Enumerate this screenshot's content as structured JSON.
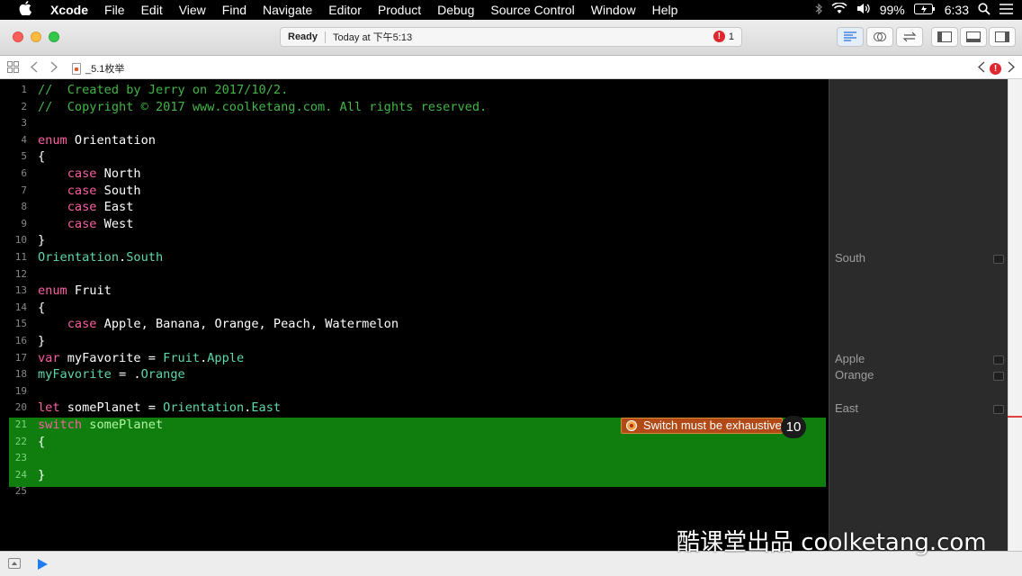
{
  "menubar": {
    "app": "Xcode",
    "items": [
      "File",
      "Edit",
      "View",
      "Find",
      "Navigate",
      "Editor",
      "Product",
      "Debug",
      "Source Control",
      "Window",
      "Help"
    ],
    "battery": "99%",
    "time": "6:33",
    "icons": [
      "apple-icon",
      "bluetooth-icon",
      "wifi-icon",
      "volume-icon",
      "battery-icon",
      "spotlight-icon"
    ]
  },
  "toolbar": {
    "status": "Ready",
    "timestamp": "Today at 下午5:13",
    "error_count": "1",
    "buttons": [
      "standard-editor-icon",
      "assistant-editor-icon",
      "version-editor-icon",
      "navigator-toggle-icon",
      "debug-area-toggle-icon",
      "utilities-toggle-icon"
    ]
  },
  "jumpbar": {
    "file": "_5.1枚举",
    "icons": [
      "related-items-icon",
      "back-icon",
      "forward-icon",
      "swift-file-icon",
      "previous-issue-icon",
      "error-icon",
      "next-issue-icon"
    ]
  },
  "editor": {
    "lines": [
      {
        "n": "1",
        "parts": [
          {
            "t": "//  Created by Jerry on 2017/10/2.",
            "c": "comment"
          }
        ]
      },
      {
        "n": "2",
        "parts": [
          {
            "t": "//  Copyright © 2017 www.coolketang.com. All rights reserved.",
            "c": "comment"
          }
        ]
      },
      {
        "n": "3",
        "parts": []
      },
      {
        "n": "4",
        "parts": [
          {
            "t": "enum",
            "c": "kw"
          },
          {
            "t": " Orientation",
            "c": "plain"
          }
        ]
      },
      {
        "n": "5",
        "parts": [
          {
            "t": "{",
            "c": "plain"
          }
        ]
      },
      {
        "n": "6",
        "parts": [
          {
            "t": "    ",
            "c": "plain"
          },
          {
            "t": "case",
            "c": "kw"
          },
          {
            "t": " North",
            "c": "plain"
          }
        ]
      },
      {
        "n": "7",
        "parts": [
          {
            "t": "    ",
            "c": "plain"
          },
          {
            "t": "case",
            "c": "kw"
          },
          {
            "t": " South",
            "c": "plain"
          }
        ]
      },
      {
        "n": "8",
        "parts": [
          {
            "t": "    ",
            "c": "plain"
          },
          {
            "t": "case",
            "c": "kw"
          },
          {
            "t": " East",
            "c": "plain"
          }
        ]
      },
      {
        "n": "9",
        "parts": [
          {
            "t": "    ",
            "c": "plain"
          },
          {
            "t": "case",
            "c": "kw"
          },
          {
            "t": " West",
            "c": "plain"
          }
        ]
      },
      {
        "n": "10",
        "parts": [
          {
            "t": "}",
            "c": "plain"
          }
        ]
      },
      {
        "n": "11",
        "parts": [
          {
            "t": "Orientation",
            "c": "type"
          },
          {
            "t": ".",
            "c": "plain"
          },
          {
            "t": "South",
            "c": "type"
          }
        ]
      },
      {
        "n": "12",
        "parts": []
      },
      {
        "n": "13",
        "parts": [
          {
            "t": "enum",
            "c": "kw"
          },
          {
            "t": " Fruit",
            "c": "plain"
          }
        ]
      },
      {
        "n": "14",
        "parts": [
          {
            "t": "{",
            "c": "plain"
          }
        ]
      },
      {
        "n": "15",
        "parts": [
          {
            "t": "    ",
            "c": "plain"
          },
          {
            "t": "case",
            "c": "kw"
          },
          {
            "t": " Apple, Banana, Orange, Peach, Watermelon",
            "c": "plain"
          }
        ]
      },
      {
        "n": "16",
        "parts": [
          {
            "t": "}",
            "c": "plain"
          }
        ]
      },
      {
        "n": "17",
        "parts": [
          {
            "t": "var",
            "c": "kw"
          },
          {
            "t": " myFavorite = ",
            "c": "plain"
          },
          {
            "t": "Fruit",
            "c": "type"
          },
          {
            "t": ".",
            "c": "plain"
          },
          {
            "t": "Apple",
            "c": "type"
          }
        ]
      },
      {
        "n": "18",
        "parts": [
          {
            "t": "myFavorite",
            "c": "type"
          },
          {
            "t": " = .",
            "c": "plain"
          },
          {
            "t": "Orange",
            "c": "type"
          }
        ]
      },
      {
        "n": "19",
        "parts": []
      },
      {
        "n": "20",
        "parts": [
          {
            "t": "let",
            "c": "kw"
          },
          {
            "t": " somePlanet = ",
            "c": "plain"
          },
          {
            "t": "Orientation",
            "c": "type"
          },
          {
            "t": ".",
            "c": "plain"
          },
          {
            "t": "East",
            "c": "type"
          }
        ]
      },
      {
        "n": "21",
        "parts": [
          {
            "t": "switch",
            "c": "kw"
          },
          {
            "t": " somePlanet",
            "c": "ident"
          }
        ]
      },
      {
        "n": "22",
        "parts": [
          {
            "t": "{",
            "c": "plain"
          }
        ]
      },
      {
        "n": "23",
        "parts": []
      },
      {
        "n": "24",
        "parts": [
          {
            "t": "}",
            "c": "plain"
          }
        ]
      },
      {
        "n": "25",
        "parts": []
      }
    ],
    "issue_message": "Switch must be exhaustive",
    "issue_count": "10"
  },
  "results": [
    {
      "line": "11",
      "value": "South"
    },
    {
      "line": "17",
      "value": "Apple"
    },
    {
      "line": "18",
      "value": "Orange"
    },
    {
      "line": "20",
      "value": "East"
    }
  ],
  "watermark": "酷课堂出品 coolketang.com"
}
